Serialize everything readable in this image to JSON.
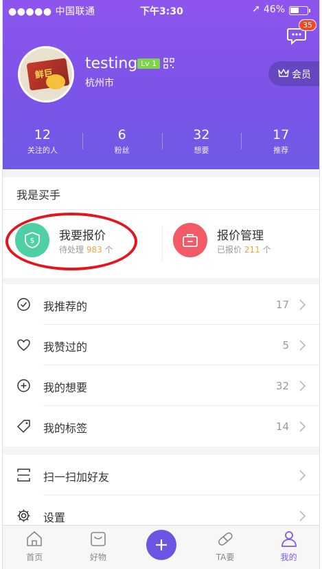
{
  "status_bar": {
    "carrier": "●●●●● 中国联通",
    "time": "下午3:30",
    "battery": "46%"
  },
  "header": {
    "message_badge": "35",
    "username": "testing",
    "level": "Lv 1",
    "city": "杭州市",
    "vip_label": "会员",
    "avatar_text": "鲜巨"
  },
  "stats": [
    {
      "value": "12",
      "label": "关注的人"
    },
    {
      "value": "6",
      "label": "粉丝"
    },
    {
      "value": "32",
      "label": "想要"
    },
    {
      "value": "17",
      "label": "推荐"
    }
  ],
  "buyer": {
    "title": "我是买手",
    "quote": {
      "name": "我要报价",
      "sub_prefix": "待处理",
      "count": "983",
      "sub_suffix": "个"
    },
    "manage": {
      "name": "报价管理",
      "sub_prefix": "已报价",
      "count": "211",
      "sub_suffix": "个"
    }
  },
  "list1": [
    {
      "label": "我推荐的",
      "count": "17",
      "icon": "check-circle-icon"
    },
    {
      "label": "我赞过的",
      "count": "5",
      "icon": "heart-icon"
    },
    {
      "label": "我的想要",
      "count": "32",
      "icon": "plus-circle-icon"
    },
    {
      "label": "我的标签",
      "count": "14",
      "icon": "tag-icon"
    }
  ],
  "list2": [
    {
      "label": "扫一扫加好友",
      "icon": "scan-icon"
    },
    {
      "label": "设置",
      "icon": "gear-icon"
    }
  ],
  "tabs": [
    {
      "label": "首页",
      "icon": "home-icon"
    },
    {
      "label": "好物",
      "icon": "bag-icon"
    },
    {
      "label": "",
      "icon": "plus-icon"
    },
    {
      "label": "TA要",
      "icon": "pill-icon"
    },
    {
      "label": "我的",
      "icon": "person-icon"
    }
  ],
  "colors": {
    "header_purple": "#7a54e6",
    "accent_yellow": "#f1a43b",
    "quote_green": "#4fcfa4",
    "manage_red": "#f25a66",
    "annotation_red": "#e6141c"
  }
}
